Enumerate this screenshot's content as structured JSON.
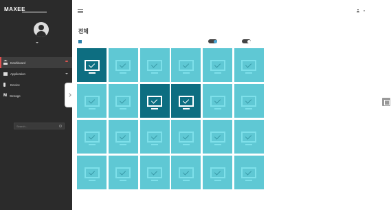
{
  "sidebar": {
    "brand": "MAXEE",
    "user_name": "",
    "items": [
      {
        "label": "Dashboard",
        "badge": "",
        "icon": "home-icon"
      },
      {
        "label": "Application",
        "icon": "app-icon"
      },
      {
        "label": "Device",
        "icon": "phone-icon"
      },
      {
        "label": "Storage",
        "icon": "m-icon"
      }
    ],
    "search_placeholder": "Search..."
  },
  "header": {
    "user_name": ""
  },
  "main": {
    "title": "전체",
    "select_all_label": "",
    "toggle1_label": "",
    "toggle1_value": "ON",
    "toggle2_label": ""
  },
  "tiles": [
    {
      "name": "",
      "selected": true
    },
    {
      "name": "",
      "selected": false
    },
    {
      "name": "",
      "selected": false
    },
    {
      "name": "",
      "selected": false
    },
    {
      "name": "",
      "selected": false
    },
    {
      "name": "",
      "selected": false
    },
    {
      "name": "",
      "selected": false
    },
    {
      "name": "",
      "selected": false
    },
    {
      "name": "",
      "selected": true
    },
    {
      "name": "",
      "selected": true
    },
    {
      "name": "",
      "selected": false
    },
    {
      "name": "",
      "selected": false
    },
    {
      "name": "",
      "selected": false
    },
    {
      "name": "",
      "selected": false
    },
    {
      "name": "",
      "selected": false
    },
    {
      "name": "",
      "selected": false
    },
    {
      "name": "",
      "selected": false
    },
    {
      "name": "",
      "selected": false
    },
    {
      "name": "",
      "selected": false
    },
    {
      "name": "",
      "selected": false
    },
    {
      "name": "",
      "selected": false
    },
    {
      "name": "",
      "selected": false
    },
    {
      "name": "",
      "selected": false
    },
    {
      "name": "",
      "selected": false
    }
  ],
  "colors": {
    "sidebar_bg": "#2b2b2b",
    "tile": "#5fc8d4",
    "tile_selected": "#0d6e81",
    "badge": "#d9534f"
  }
}
